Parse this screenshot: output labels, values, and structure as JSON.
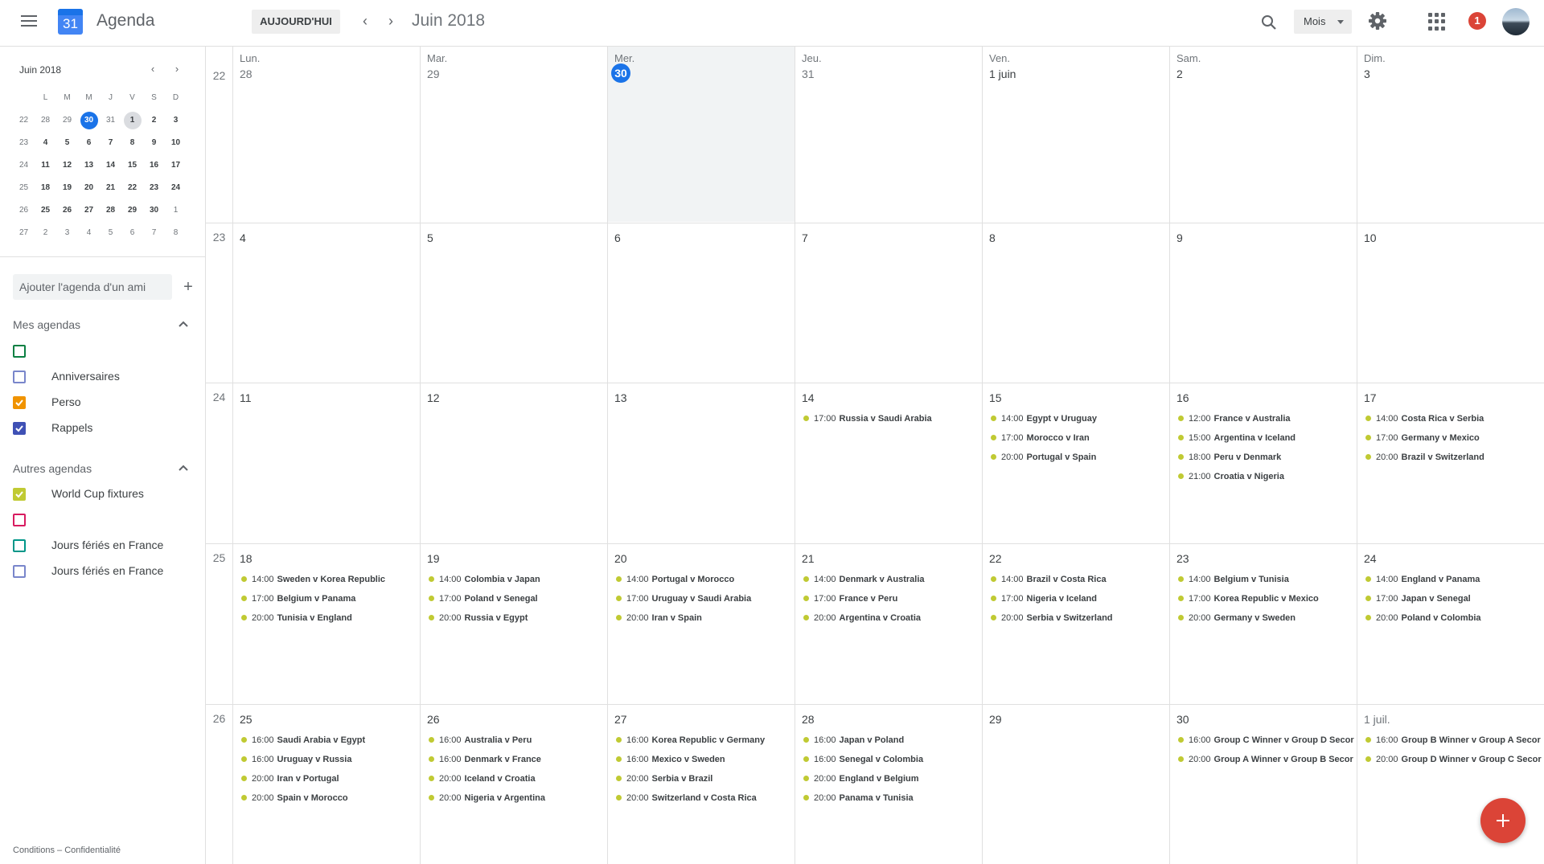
{
  "header": {
    "logo_number": "31",
    "app_title": "Agenda",
    "today_label": "AUJOURD'HUI",
    "period": "Juin 2018",
    "view_label": "Mois",
    "notifications": "1"
  },
  "mini_calendar": {
    "title": "Juin 2018",
    "weekday_headers": [
      "L",
      "M",
      "M",
      "J",
      "V",
      "S",
      "D"
    ],
    "weeks": [
      {
        "num": "22",
        "days": [
          "28",
          "29",
          "30",
          "31",
          "1",
          "2",
          "3"
        ]
      },
      {
        "num": "23",
        "days": [
          "4",
          "5",
          "6",
          "7",
          "8",
          "9",
          "10"
        ]
      },
      {
        "num": "24",
        "days": [
          "11",
          "12",
          "13",
          "14",
          "15",
          "16",
          "17"
        ]
      },
      {
        "num": "25",
        "days": [
          "18",
          "19",
          "20",
          "21",
          "22",
          "23",
          "24"
        ]
      },
      {
        "num": "26",
        "days": [
          "25",
          "26",
          "27",
          "28",
          "29",
          "30",
          "1"
        ]
      },
      {
        "num": "27",
        "days": [
          "2",
          "3",
          "4",
          "5",
          "6",
          "7",
          "8"
        ]
      }
    ]
  },
  "sidebar": {
    "add_friend_placeholder": "Ajouter l'agenda d'un ami",
    "my_calendars_title": "Mes agendas",
    "my_calendars": [
      {
        "label": "",
        "color": "#0b8043",
        "checked": false
      },
      {
        "label": "Anniversaires",
        "color": "#7986cb",
        "checked": false
      },
      {
        "label": "Perso",
        "color": "#f09300",
        "checked": true
      },
      {
        "label": "Rappels",
        "color": "#3f51b5",
        "checked": true
      }
    ],
    "other_calendars_title": "Autres agendas",
    "other_calendars": [
      {
        "label": "World Cup fixtures",
        "color": "#c0ca33",
        "checked": true
      },
      {
        "label": "",
        "color": "#d81b60",
        "checked": false
      },
      {
        "label": "Jours fériés en France",
        "color": "#009688",
        "checked": false
      },
      {
        "label": "Jours fériés en France",
        "color": "#7986cb",
        "checked": false
      }
    ],
    "footer_terms": "Conditions",
    "footer_sep": " – ",
    "footer_privacy": "Confidentialité"
  },
  "month": {
    "weekdays": [
      "Lun.",
      "Mar.",
      "Mer.",
      "Jeu.",
      "Ven.",
      "Sam.",
      "Dim."
    ],
    "event_color": "#c0ca33",
    "weeks": [
      {
        "num": "22",
        "days": [
          {
            "label": "28",
            "dim": true,
            "events": []
          },
          {
            "label": "29",
            "dim": true,
            "events": []
          },
          {
            "label": "30",
            "today": true,
            "events": []
          },
          {
            "label": "31",
            "dim": true,
            "events": []
          },
          {
            "label": "1 juin",
            "events": []
          },
          {
            "label": "2",
            "events": []
          },
          {
            "label": "3",
            "events": []
          }
        ]
      },
      {
        "num": "23",
        "days": [
          {
            "label": "4",
            "events": []
          },
          {
            "label": "5",
            "events": []
          },
          {
            "label": "6",
            "events": []
          },
          {
            "label": "7",
            "events": []
          },
          {
            "label": "8",
            "events": []
          },
          {
            "label": "9",
            "events": []
          },
          {
            "label": "10",
            "events": []
          }
        ]
      },
      {
        "num": "24",
        "days": [
          {
            "label": "11",
            "events": []
          },
          {
            "label": "12",
            "events": []
          },
          {
            "label": "13",
            "events": []
          },
          {
            "label": "14",
            "events": [
              {
                "time": "17:00",
                "title": "Russia v Saudi Arabia"
              }
            ]
          },
          {
            "label": "15",
            "events": [
              {
                "time": "14:00",
                "title": "Egypt v Uruguay"
              },
              {
                "time": "17:00",
                "title": "Morocco v Iran"
              },
              {
                "time": "20:00",
                "title": "Portugal v Spain"
              }
            ]
          },
          {
            "label": "16",
            "events": [
              {
                "time": "12:00",
                "title": "France v Australia"
              },
              {
                "time": "15:00",
                "title": "Argentina v Iceland"
              },
              {
                "time": "18:00",
                "title": "Peru v Denmark"
              },
              {
                "time": "21:00",
                "title": "Croatia v Nigeria"
              }
            ]
          },
          {
            "label": "17",
            "events": [
              {
                "time": "14:00",
                "title": "Costa Rica v Serbia"
              },
              {
                "time": "17:00",
                "title": "Germany v Mexico"
              },
              {
                "time": "20:00",
                "title": "Brazil v Switzerland"
              }
            ]
          }
        ]
      },
      {
        "num": "25",
        "days": [
          {
            "label": "18",
            "events": [
              {
                "time": "14:00",
                "title": "Sweden v Korea Republic"
              },
              {
                "time": "17:00",
                "title": "Belgium v Panama"
              },
              {
                "time": "20:00",
                "title": "Tunisia v England"
              }
            ]
          },
          {
            "label": "19",
            "events": [
              {
                "time": "14:00",
                "title": "Colombia v Japan"
              },
              {
                "time": "17:00",
                "title": "Poland v Senegal"
              },
              {
                "time": "20:00",
                "title": "Russia v Egypt"
              }
            ]
          },
          {
            "label": "20",
            "events": [
              {
                "time": "14:00",
                "title": "Portugal v Morocco"
              },
              {
                "time": "17:00",
                "title": "Uruguay v Saudi Arabia"
              },
              {
                "time": "20:00",
                "title": "Iran v Spain"
              }
            ]
          },
          {
            "label": "21",
            "events": [
              {
                "time": "14:00",
                "title": "Denmark v Australia"
              },
              {
                "time": "17:00",
                "title": "France v Peru"
              },
              {
                "time": "20:00",
                "title": "Argentina v Croatia"
              }
            ]
          },
          {
            "label": "22",
            "events": [
              {
                "time": "14:00",
                "title": "Brazil v Costa Rica"
              },
              {
                "time": "17:00",
                "title": "Nigeria v Iceland"
              },
              {
                "time": "20:00",
                "title": "Serbia v Switzerland"
              }
            ]
          },
          {
            "label": "23",
            "events": [
              {
                "time": "14:00",
                "title": "Belgium v Tunisia"
              },
              {
                "time": "17:00",
                "title": "Korea Republic v Mexico"
              },
              {
                "time": "20:00",
                "title": "Germany v Sweden"
              }
            ]
          },
          {
            "label": "24",
            "events": [
              {
                "time": "14:00",
                "title": "England v Panama"
              },
              {
                "time": "17:00",
                "title": "Japan v Senegal"
              },
              {
                "time": "20:00",
                "title": "Poland v Colombia"
              }
            ]
          }
        ]
      },
      {
        "num": "26",
        "days": [
          {
            "label": "25",
            "events": [
              {
                "time": "16:00",
                "title": "Saudi Arabia v Egypt"
              },
              {
                "time": "16:00",
                "title": "Uruguay v Russia"
              },
              {
                "time": "20:00",
                "title": "Iran v Portugal"
              },
              {
                "time": "20:00",
                "title": "Spain v Morocco"
              }
            ]
          },
          {
            "label": "26",
            "events": [
              {
                "time": "16:00",
                "title": "Australia v Peru"
              },
              {
                "time": "16:00",
                "title": "Denmark v France"
              },
              {
                "time": "20:00",
                "title": "Iceland v Croatia"
              },
              {
                "time": "20:00",
                "title": "Nigeria v Argentina"
              }
            ]
          },
          {
            "label": "27",
            "events": [
              {
                "time": "16:00",
                "title": "Korea Republic v Germany"
              },
              {
                "time": "16:00",
                "title": "Mexico v Sweden"
              },
              {
                "time": "20:00",
                "title": "Serbia v Brazil"
              },
              {
                "time": "20:00",
                "title": "Switzerland v Costa Rica"
              }
            ]
          },
          {
            "label": "28",
            "events": [
              {
                "time": "16:00",
                "title": "Japan v Poland"
              },
              {
                "time": "16:00",
                "title": "Senegal v Colombia"
              },
              {
                "time": "20:00",
                "title": "England v Belgium"
              },
              {
                "time": "20:00",
                "title": "Panama v Tunisia"
              }
            ]
          },
          {
            "label": "29",
            "events": []
          },
          {
            "label": "30",
            "events": [
              {
                "time": "16:00",
                "title": "Group C Winner v Group D Secor"
              },
              {
                "time": "20:00",
                "title": "Group A Winner v Group B Secor"
              }
            ]
          },
          {
            "label": "1 juil.",
            "dim": true,
            "events": [
              {
                "time": "16:00",
                "title": "Group B Winner v Group A Secor"
              },
              {
                "time": "20:00",
                "title": "Group D Winner v Group C Secor"
              }
            ]
          }
        ]
      }
    ]
  }
}
